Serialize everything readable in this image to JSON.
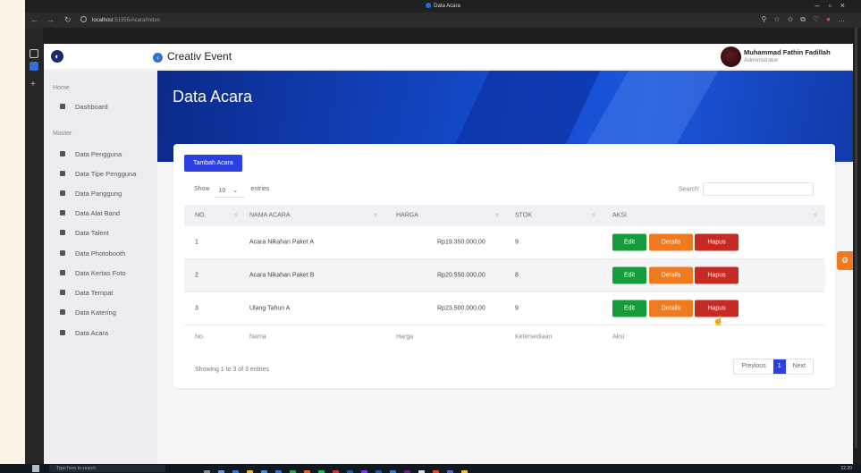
{
  "browser": {
    "window_title": "Data Acara",
    "url_host": "localhost",
    "url_rest": ":51955/Acara/Index"
  },
  "app": {
    "brand": "Creativ Event",
    "user": {
      "name": "Muhammad Fathin Fadillah",
      "role": "Administrator"
    }
  },
  "sidebar": {
    "home_label": "Home",
    "home_items": [
      {
        "label": "Dashboard"
      }
    ],
    "master_label": "Master",
    "master_items": [
      {
        "label": "Data Pengguna"
      },
      {
        "label": "Data Tipe Pengguna"
      },
      {
        "label": "Data Panggung"
      },
      {
        "label": "Data Alat Band"
      },
      {
        "label": "Data Talent"
      },
      {
        "label": "Data Photobooth"
      },
      {
        "label": "Data Kertas Foto"
      },
      {
        "label": "Data Tempat"
      },
      {
        "label": "Data Katering"
      },
      {
        "label": "Data Acara"
      }
    ]
  },
  "page": {
    "title": "Data Acara",
    "add_button": "Tambah Acara",
    "show_label": "Show",
    "entries_value": "10",
    "entries_label": "entries",
    "search_label": "Search:",
    "table": {
      "headers": [
        "NO.",
        "NAMA ACARA",
        "HARGA",
        "STOK",
        "AKSI"
      ],
      "rows": [
        {
          "no": "1",
          "nama": "Acara Nikahan Paket A",
          "harga": "Rp19.350.000,00",
          "stok": "9"
        },
        {
          "no": "2",
          "nama": "Acara Nikahan Paket B",
          "harga": "Rp20.550.000,00",
          "stok": "8"
        },
        {
          "no": "3",
          "nama": "Ulang Tahun A",
          "harga": "Rp23.500.000,00",
          "stok": "9"
        }
      ],
      "footer": [
        "No.",
        "Nama",
        "Harga",
        "Ketersediaan",
        "Aksi"
      ],
      "actions": {
        "edit": "Edit",
        "details": "Details",
        "delete": "Hapus"
      }
    },
    "showing_text": "Showing 1 to 3 of 3 entries",
    "pager": {
      "previous": "Previous",
      "current": "1",
      "next": "Next"
    }
  },
  "taskbar": {
    "search_placeholder": "Type here to search",
    "time": "12.20"
  }
}
